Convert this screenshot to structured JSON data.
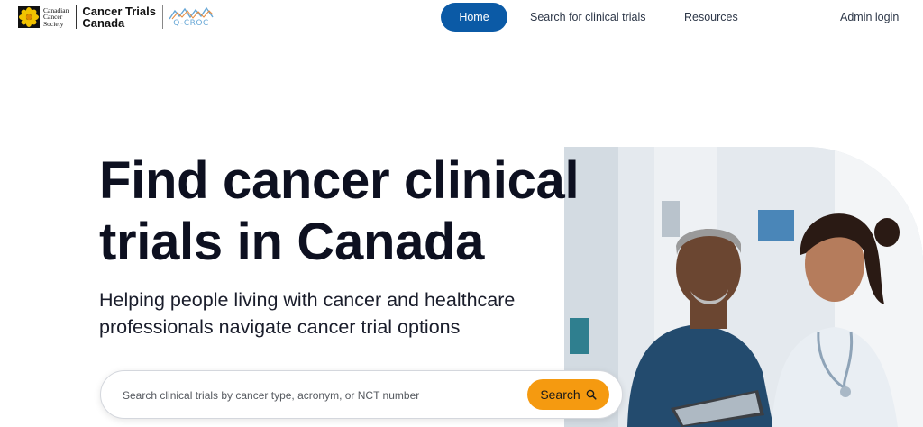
{
  "header": {
    "ccs_logo_lines": [
      "Canadian",
      "Cancer",
      "Society"
    ],
    "ctc_lines": [
      "Cancer Trials",
      "Canada"
    ],
    "qcroc_text": "Q-CROC",
    "nav": {
      "home": "Home",
      "search": "Search for clinical trials",
      "resources": "Resources",
      "admin": "Admin login"
    }
  },
  "hero": {
    "title_line1": "Find cancer clinical",
    "title_line2": "trials in Canada",
    "subtitle_line1": "Helping people living with cancer and healthcare",
    "subtitle_line2": "professionals navigate cancer trial options"
  },
  "search": {
    "placeholder": "Search clinical trials by cancer type, acronym, or NCT number",
    "button_label": "Search"
  },
  "colors": {
    "primary": "#0b5aa6",
    "accent": "#f59a10",
    "text": "#0d1020",
    "qcroc_blue": "#67a7d6",
    "ccs_yellow": "#f2c200"
  },
  "icons": [
    "daffodil-icon",
    "qcroc-mountain-icon",
    "search-icon"
  ]
}
